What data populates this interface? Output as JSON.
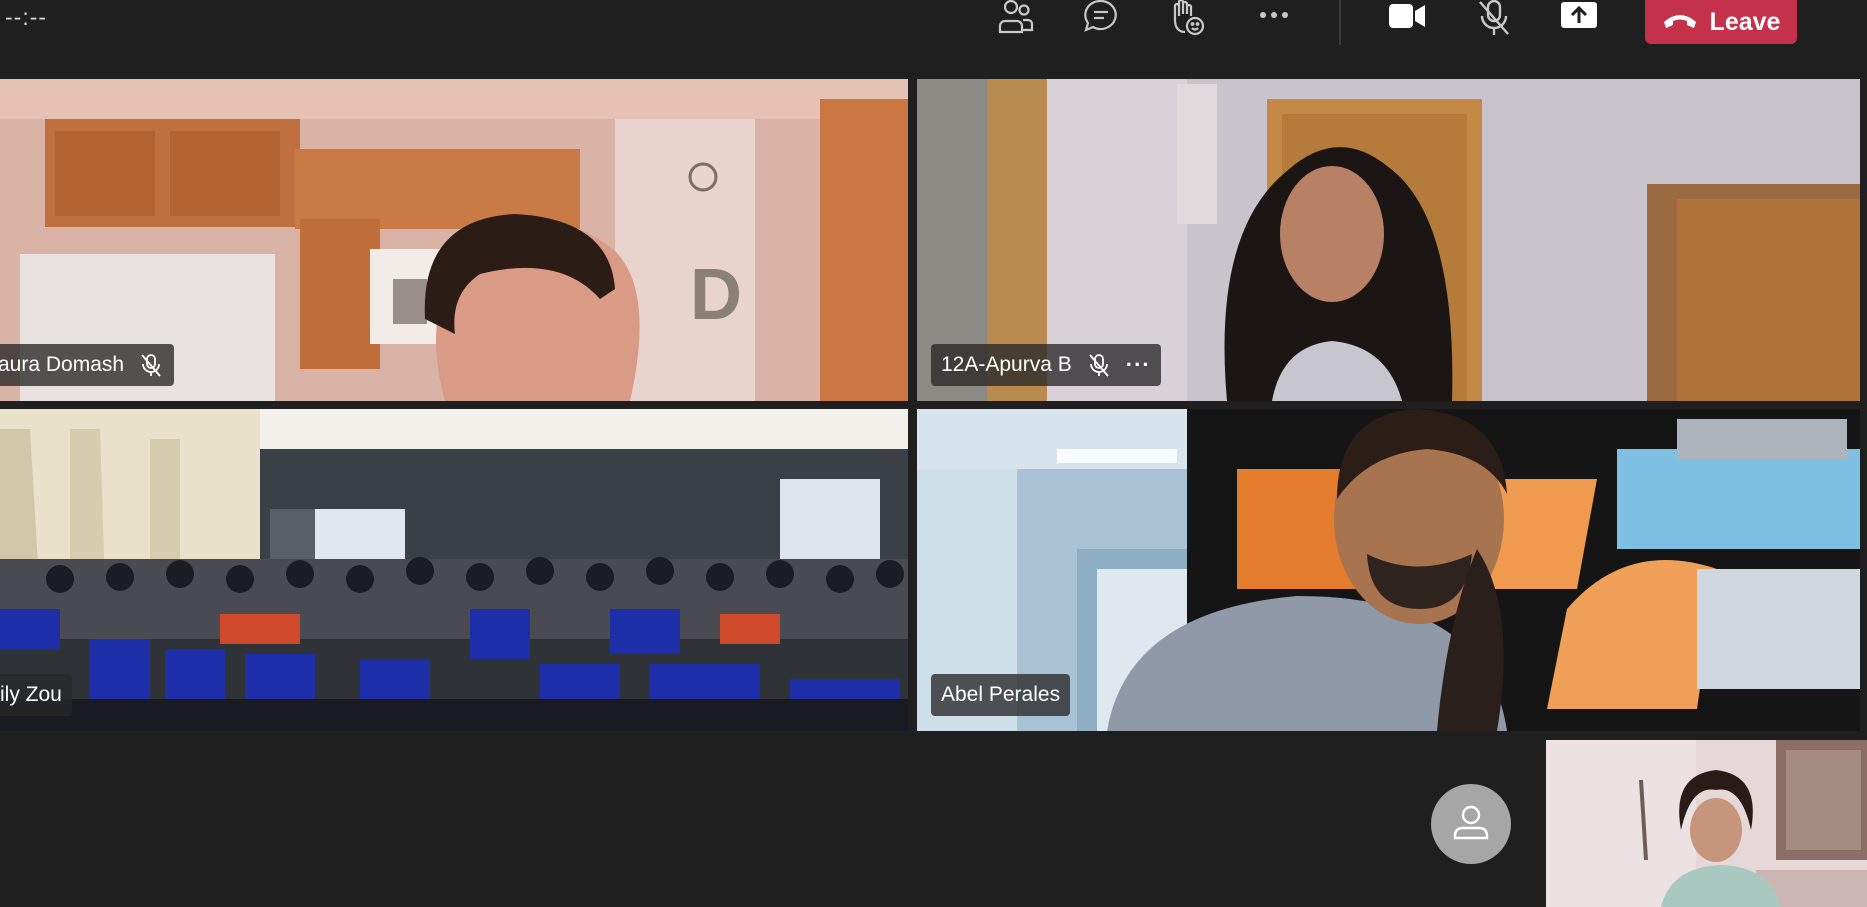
{
  "toolbar": {
    "timer": "--:--",
    "leave_label": "Leave",
    "icons": [
      "people-icon",
      "chat-icon",
      "raise-hand-icon",
      "more-options-icon",
      "camera-icon",
      "mic-off-icon",
      "share-screen-icon",
      "hangup-icon"
    ]
  },
  "participants": [
    {
      "name": "aura Domash",
      "muted": true
    },
    {
      "name": "12A-Apurva B",
      "muted": true
    },
    {
      "name": "ily Zou",
      "muted": false
    },
    {
      "name": "Abel Perales",
      "muted": false
    }
  ],
  "colors": {
    "leave": "#c4314b",
    "background": "#1f1f1f"
  }
}
